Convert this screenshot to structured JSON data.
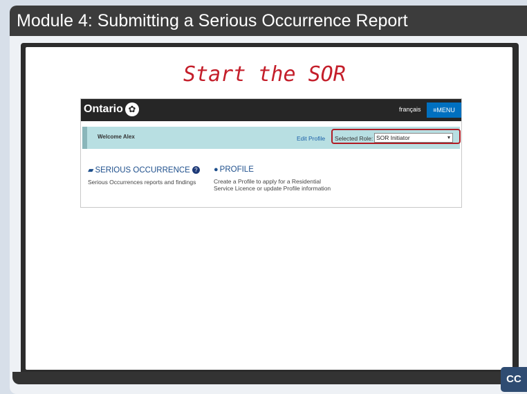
{
  "header": {
    "title": "Module 4:  Submitting a Serious Occurrence Report"
  },
  "slide": {
    "heading": "Start the SOR"
  },
  "ontario_portal": {
    "logo_text": "Ontario",
    "language_link": "français",
    "menu_label": "≡MENU",
    "welcome_text": "Welcome Alex",
    "edit_profile_label": "Edit Profile",
    "role_label": "Selected Role:",
    "role_value": "SOR Initiator",
    "tiles": [
      {
        "title": "SERIOUS OCCURRENCE",
        "description": "Serious Occurrences reports and findings",
        "icon": "briefcase-icon"
      },
      {
        "title": "PROFILE",
        "description": "Create a Profile to apply for a Residential Service Licence or update Profile information",
        "icon": "person-icon"
      }
    ]
  },
  "player": {
    "cc_label": "CC"
  },
  "colors": {
    "header_bg": "#3c3c3c",
    "heading_red": "#c41e2a",
    "welcome_bar": "#b8dfe2",
    "highlight_red": "#b11c24",
    "link_blue": "#1e4f8c",
    "menu_blue": "#0070c0"
  }
}
